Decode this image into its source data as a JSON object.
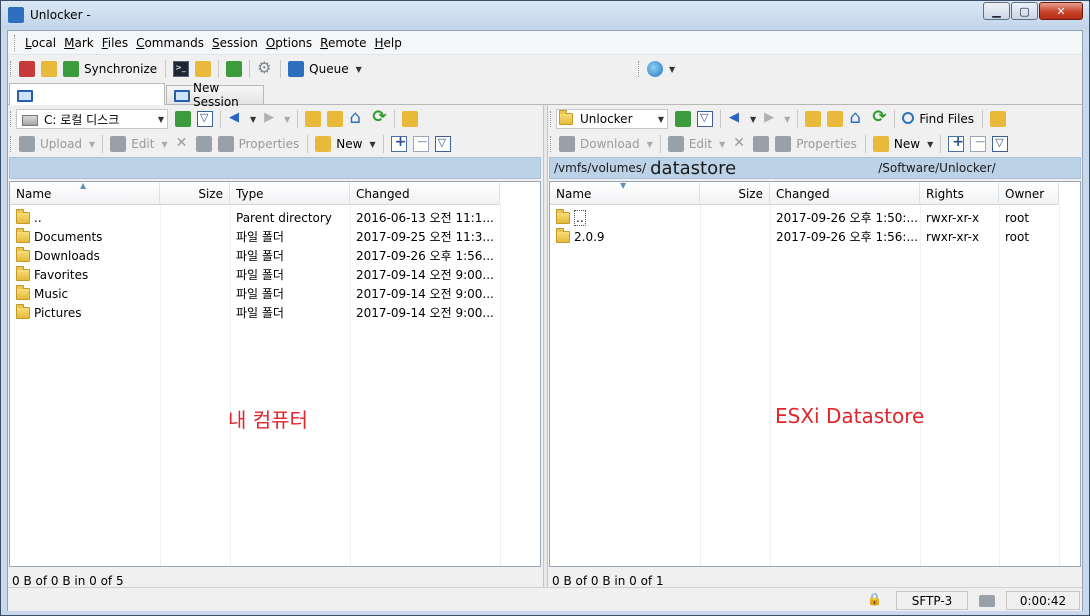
{
  "window": {
    "title": "Unlocker -"
  },
  "menu": [
    {
      "label": "Local"
    },
    {
      "label": "Mark"
    },
    {
      "label": "Files"
    },
    {
      "label": "Commands"
    },
    {
      "label": "Session"
    },
    {
      "label": "Options"
    },
    {
      "label": "Remote"
    },
    {
      "label": "Help"
    }
  ],
  "toolbar": {
    "synchronize": "Synchronize",
    "queue": "Queue"
  },
  "tabs": {
    "active_label": "",
    "new_session": "New Session"
  },
  "left": {
    "drive": "C: 로컬 디스크",
    "actions": {
      "upload": "Upload",
      "edit": "Edit",
      "properties": "Properties",
      "new": "New"
    },
    "columns": [
      "Name",
      "Size",
      "Type",
      "Changed"
    ],
    "rows": [
      {
        "name": "..",
        "size": "",
        "type": "Parent directory",
        "changed": "2016-06-13 오전 11:1..."
      },
      {
        "name": "Documents",
        "size": "",
        "type": "파일 폴더",
        "changed": "2017-09-25 오전 11:3..."
      },
      {
        "name": "Downloads",
        "size": "",
        "type": "파일 폴더",
        "changed": "2017-09-26 오후 1:56..."
      },
      {
        "name": "Favorites",
        "size": "",
        "type": "파일 폴더",
        "changed": "2017-09-14 오전 9:00..."
      },
      {
        "name": "Music",
        "size": "",
        "type": "파일 폴더",
        "changed": "2017-09-14 오전 9:00..."
      },
      {
        "name": "Pictures",
        "size": "",
        "type": "파일 폴더",
        "changed": "2017-09-14 오전 9:00..."
      }
    ],
    "annotation": "내 컴퓨터",
    "status": "0 B of 0 B in 0 of 5"
  },
  "right": {
    "folder": "Unlocker",
    "find_files": "Find Files",
    "actions": {
      "download": "Download",
      "edit": "Edit",
      "properties": "Properties",
      "new": "New"
    },
    "path_prefix": "/vmfs/volumes/",
    "path_datastore": "datastore",
    "path_suffix": "/Software/Unlocker/",
    "columns": [
      "Name",
      "Size",
      "Changed",
      "Rights",
      "Owner"
    ],
    "rows": [
      {
        "name": "..",
        "size": "",
        "changed": "2017-09-26 오후 1:50:...",
        "rights": "rwxr-xr-x",
        "owner": "root"
      },
      {
        "name": "2.0.9",
        "size": "",
        "changed": "2017-09-26 오후 1:56:...",
        "rights": "rwxr-xr-x",
        "owner": "root"
      }
    ],
    "annotation": "ESXi Datastore",
    "status": "0 B of 0 B in 0 of 1"
  },
  "statusbar": {
    "protocol": "SFTP-3",
    "time": "0:00:42"
  }
}
